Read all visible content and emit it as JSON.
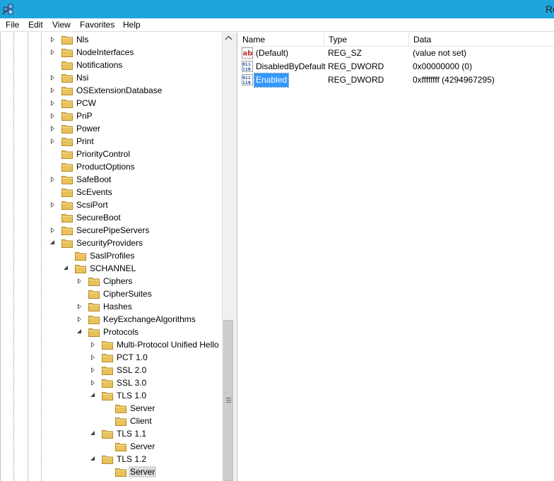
{
  "window": {
    "title": "Registry Editor",
    "title_visible": "Re"
  },
  "menu": [
    "File",
    "Edit",
    "View",
    "Favorites",
    "Help"
  ],
  "tree": {
    "items": [
      {
        "label": "Nls",
        "level": 0,
        "state": "closed"
      },
      {
        "label": "NodeInterfaces",
        "level": 0,
        "state": "closed"
      },
      {
        "label": "Notifications",
        "level": 0,
        "state": "none"
      },
      {
        "label": "Nsi",
        "level": 0,
        "state": "closed"
      },
      {
        "label": "OSExtensionDatabase",
        "level": 0,
        "state": "closed"
      },
      {
        "label": "PCW",
        "level": 0,
        "state": "closed"
      },
      {
        "label": "PnP",
        "level": 0,
        "state": "closed"
      },
      {
        "label": "Power",
        "level": 0,
        "state": "closed"
      },
      {
        "label": "Print",
        "level": 0,
        "state": "closed"
      },
      {
        "label": "PriorityControl",
        "level": 0,
        "state": "none"
      },
      {
        "label": "ProductOptions",
        "level": 0,
        "state": "none"
      },
      {
        "label": "SafeBoot",
        "level": 0,
        "state": "closed"
      },
      {
        "label": "ScEvents",
        "level": 0,
        "state": "none"
      },
      {
        "label": "ScsiPort",
        "level": 0,
        "state": "closed"
      },
      {
        "label": "SecureBoot",
        "level": 0,
        "state": "none"
      },
      {
        "label": "SecurePipeServers",
        "level": 0,
        "state": "closed"
      },
      {
        "label": "SecurityProviders",
        "level": 0,
        "state": "open"
      },
      {
        "label": "SaslProfiles",
        "level": 1,
        "state": "none"
      },
      {
        "label": "SCHANNEL",
        "level": 1,
        "state": "open"
      },
      {
        "label": "Ciphers",
        "level": 2,
        "state": "closed"
      },
      {
        "label": "CipherSuites",
        "level": 2,
        "state": "none"
      },
      {
        "label": "Hashes",
        "level": 2,
        "state": "closed"
      },
      {
        "label": "KeyExchangeAlgorithms",
        "level": 2,
        "state": "closed"
      },
      {
        "label": "Protocols",
        "level": 2,
        "state": "open"
      },
      {
        "label": "Multi-Protocol Unified Hello",
        "level": 3,
        "state": "closed"
      },
      {
        "label": "PCT 1.0",
        "level": 3,
        "state": "closed"
      },
      {
        "label": "SSL 2.0",
        "level": 3,
        "state": "closed"
      },
      {
        "label": "SSL 3.0",
        "level": 3,
        "state": "closed"
      },
      {
        "label": "TLS 1.0",
        "level": 3,
        "state": "open"
      },
      {
        "label": "Server",
        "level": 4,
        "state": "none"
      },
      {
        "label": "Client",
        "level": 4,
        "state": "none"
      },
      {
        "label": "TLS 1.1",
        "level": 3,
        "state": "open"
      },
      {
        "label": "Server",
        "level": 4,
        "state": "none"
      },
      {
        "label": "TLS 1.2",
        "level": 3,
        "state": "open"
      },
      {
        "label": "Server",
        "level": 4,
        "state": "none",
        "selected": true
      }
    ]
  },
  "list": {
    "columns": [
      "Name",
      "Type",
      "Data"
    ],
    "rows": [
      {
        "name": "(Default)",
        "type": "REG_SZ",
        "data": "(value not set)",
        "icon": "string-value-icon"
      },
      {
        "name": "DisabledByDefault",
        "type": "REG_DWORD",
        "data": "0x00000000 (0)",
        "icon": "binary-value-icon"
      },
      {
        "name": "Enabled",
        "type": "REG_DWORD",
        "data": "0xffffffff (4294967295)",
        "icon": "binary-value-icon",
        "selected": true
      }
    ]
  },
  "colors": {
    "titlebar": "#1ea6dc",
    "selection": "#3399ff",
    "tree_selection": "#d9d9d9",
    "folder": "#e8c25a"
  }
}
